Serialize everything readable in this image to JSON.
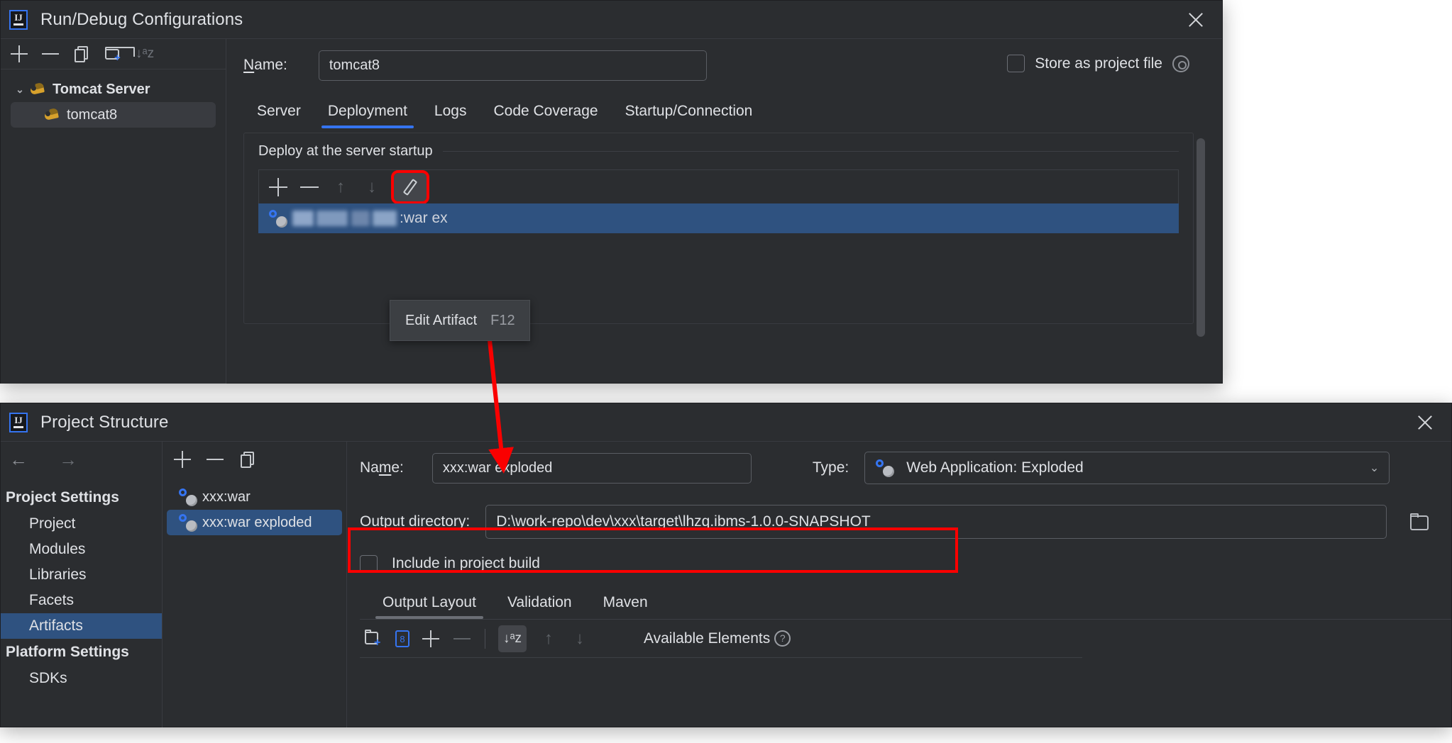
{
  "run_window": {
    "title": "Run/Debug Configurations",
    "logo_text": "IJ",
    "close_icon": "close-icon",
    "toolbar": [
      {
        "name": "add-configuration-button",
        "icon": "plus-icon"
      },
      {
        "name": "remove-configuration-button",
        "icon": "minus-icon"
      },
      {
        "name": "copy-configuration-button",
        "icon": "copy-icon"
      },
      {
        "name": "new-folder-button",
        "icon": "folder-plus-icon"
      },
      {
        "name": "sort-configurations-button",
        "icon": "sort-az-icon",
        "glyph": "↓ᵃz"
      }
    ],
    "tree": {
      "group_label": "Tomcat Server",
      "child_label": "tomcat8",
      "chevron": "⌄"
    },
    "name_label": "Name:",
    "name_label_underline": "N",
    "name_label_rest": "ame:",
    "name_value": "tomcat8",
    "store_as_project_file": {
      "label": "Store as project file",
      "checked": false,
      "gear_icon": "gear-icon"
    },
    "tabs": [
      {
        "label": "Server",
        "active": false
      },
      {
        "label": "Deployment",
        "active": true
      },
      {
        "label": "Logs",
        "active": false
      },
      {
        "label": "Code Coverage",
        "active": false
      },
      {
        "label": "Startup/Connection",
        "active": false
      }
    ],
    "deploy_section_label": "Deploy at the server startup",
    "deploy_toolbar": [
      {
        "name": "add-artifact-button",
        "icon": "plus-icon"
      },
      {
        "name": "remove-artifact-button",
        "icon": "minus-icon"
      },
      {
        "name": "move-up-button",
        "icon": "arrow-up-icon",
        "glyph": "↑"
      },
      {
        "name": "move-down-button",
        "icon": "arrow-down-icon",
        "glyph": "↓"
      },
      {
        "name": "edit-artifact-button",
        "icon": "pencil-icon",
        "highlighted": true
      }
    ],
    "artifact_row": {
      "redacted": true,
      "visible_text": ":war ex",
      "full_hint": "xxx:war exploded"
    },
    "tooltip": {
      "label": "Edit Artifact",
      "shortcut": "F12"
    }
  },
  "project_structure_window": {
    "title": "Project Structure",
    "logo_text": "IJ",
    "close_icon": "close-icon",
    "nav_back_icon": "arrow-left-icon",
    "nav_forward_icon": "arrow-right-icon",
    "nav_back_glyph": "←",
    "nav_forward_glyph": "→",
    "nav_sections": [
      {
        "header": "Project Settings",
        "items": [
          {
            "label": "Project",
            "selected": false
          },
          {
            "label": "Modules",
            "selected": false
          },
          {
            "label": "Libraries",
            "selected": false
          },
          {
            "label": "Facets",
            "selected": false
          },
          {
            "label": "Artifacts",
            "selected": true
          }
        ]
      },
      {
        "header": "Platform Settings",
        "items": [
          {
            "label": "SDKs",
            "selected": false
          }
        ]
      }
    ],
    "list_toolbar": [
      {
        "name": "add-artifact-button",
        "icon": "plus-icon"
      },
      {
        "name": "remove-artifact-button",
        "icon": "minus-icon"
      },
      {
        "name": "copy-artifact-button",
        "icon": "copy-icon"
      }
    ],
    "artifact_list": [
      {
        "label": "xxx:war",
        "selected": false
      },
      {
        "label": "xxx:war exploded",
        "selected": true
      }
    ],
    "name_label": "Name:",
    "name_value": "xxx:war exploded",
    "type_label": "Type:",
    "type_value": "Web Application: Exploded",
    "type_chevron": "⌄",
    "output_directory_label": "Output directory:",
    "output_directory_value": "D:\\work-repo\\dev\\xxx\\target\\lhzq.ibms-1.0.0-SNAPSHOT",
    "browse_icon": "folder-icon",
    "include_in_project_build": {
      "label": "Include in project build",
      "checked": false
    },
    "sub_tabs": [
      {
        "label": "Output Layout",
        "active": true
      },
      {
        "label": "Validation",
        "active": false
      },
      {
        "label": "Maven",
        "active": false
      }
    ],
    "output_toolbar": [
      {
        "name": "create-directory-button",
        "icon": "folder-plus-icon"
      },
      {
        "name": "create-archive-button",
        "icon": "archive-icon"
      },
      {
        "name": "add-copy-of-button",
        "icon": "plus-icon"
      },
      {
        "name": "remove-element-button",
        "icon": "minus-icon"
      },
      {
        "name": "sort-elements-button",
        "icon": "sort-az-icon",
        "glyph": "↓ᵃz"
      },
      {
        "name": "move-element-up-button",
        "icon": "arrow-up-icon",
        "glyph": "↑"
      },
      {
        "name": "move-element-down-button",
        "icon": "arrow-down-icon",
        "glyph": "↓"
      }
    ],
    "available_elements_label": "Available Elements",
    "help_icon": "question-mark-icon",
    "help_glyph": "?"
  },
  "annotations": {
    "highlight_color": "#fa0000",
    "arrow": "red-arrow-pointing-from-edit-artifact-to-output-directory",
    "selection_color": "#2f5280",
    "accent_color": "#3574f0"
  }
}
